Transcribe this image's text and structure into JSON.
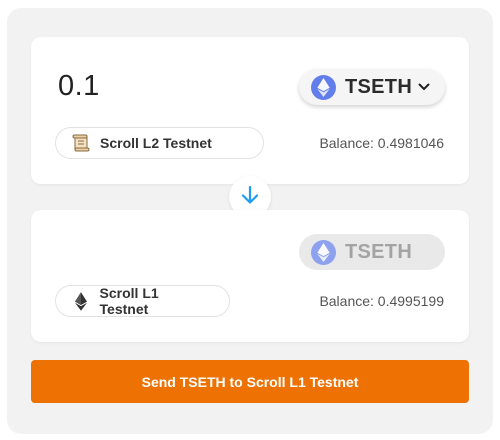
{
  "from": {
    "amount": "0.1",
    "token": "TSETH",
    "token_icon": "ethereum-icon",
    "network": "Scroll L2 Testnet",
    "network_icon": "scroll-icon",
    "balance": "Balance: 0.4981046"
  },
  "to": {
    "token": "TSETH",
    "token_icon": "ethereum-icon",
    "network": "Scroll L1 Testnet",
    "network_icon": "ethereum-icon",
    "balance": "Balance: 0.4995199"
  },
  "swap_icon": "arrow-down-icon",
  "send_button": "Send TSETH to Scroll L1 Testnet",
  "colors": {
    "accent": "#ee7203",
    "ethereum": "#627eea",
    "arrow": "#1f9cf0"
  }
}
